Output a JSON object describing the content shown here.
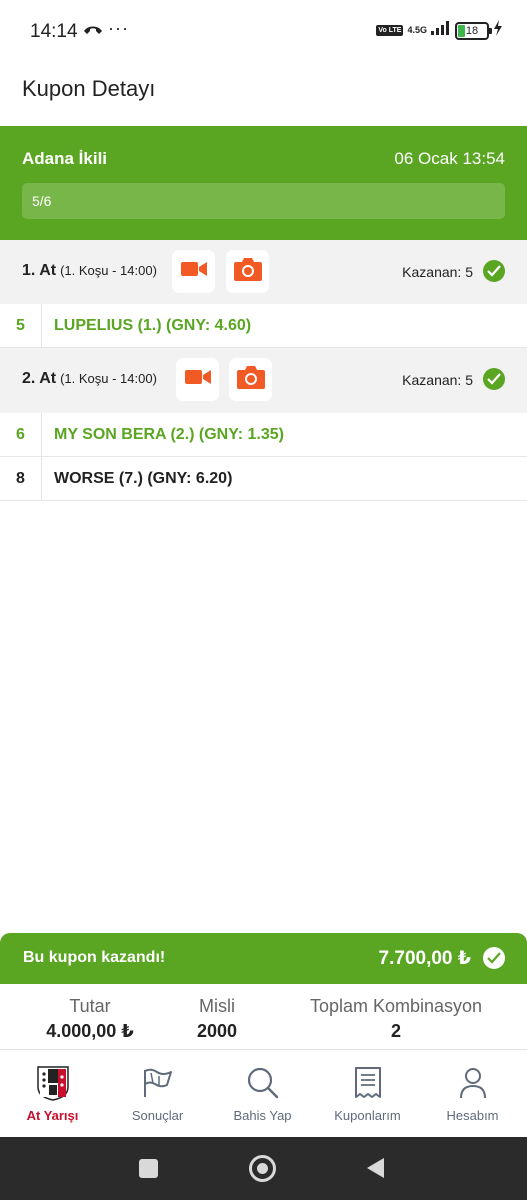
{
  "status_bar": {
    "time": "14:14",
    "dots": "···",
    "volte": "Vo LTE",
    "network": "4.5G",
    "battery": "18"
  },
  "page_title": "Kupon Detayı",
  "coupon": {
    "name": "Adana İkili",
    "date": "06 Ocak 13:54",
    "progress": "5/6",
    "progress_fraction": 0.833
  },
  "legs": [
    {
      "title": "1. At",
      "subtitle": "(1. Koşu - 14:00)",
      "winner_text": "Kazanan: 5",
      "horses": [
        {
          "number": "5",
          "name": "LUPELIUS (1.) (GNY: 4.60)",
          "won": true
        }
      ]
    },
    {
      "title": "2. At",
      "subtitle": "(1. Koşu - 14:00)",
      "winner_text": "Kazanan: 5",
      "horses": [
        {
          "number": "6",
          "name": "MY SON BERA (2.) (GNY: 1.35)",
          "won": true
        },
        {
          "number": "8",
          "name": "WORSE (7.) (GNY: 6.20)",
          "won": false
        }
      ]
    }
  ],
  "summary": {
    "win_label": "Bu kupon kazandı!",
    "win_amount": "7.700,00 ₺",
    "stats": [
      {
        "label": "Tutar",
        "value": "4.000,00 ₺"
      },
      {
        "label": "Misli",
        "value": "2000"
      },
      {
        "label": "Toplam Kombinasyon",
        "value": "2"
      }
    ]
  },
  "nav": {
    "items": [
      {
        "label": "At Yarışı",
        "icon": "horse-racing-logo-icon",
        "active": true
      },
      {
        "label": "Sonuçlar",
        "icon": "flag-icon",
        "active": false
      },
      {
        "label": "Bahis Yap",
        "icon": "search-icon",
        "active": false
      },
      {
        "label": "Kuponlarım",
        "icon": "receipt-icon",
        "active": false
      },
      {
        "label": "Hesabım",
        "icon": "user-icon",
        "active": false
      }
    ]
  },
  "colors": {
    "brand_green": "#5aa622",
    "media_orange": "#f15a24",
    "active_red": "#c8102e"
  }
}
